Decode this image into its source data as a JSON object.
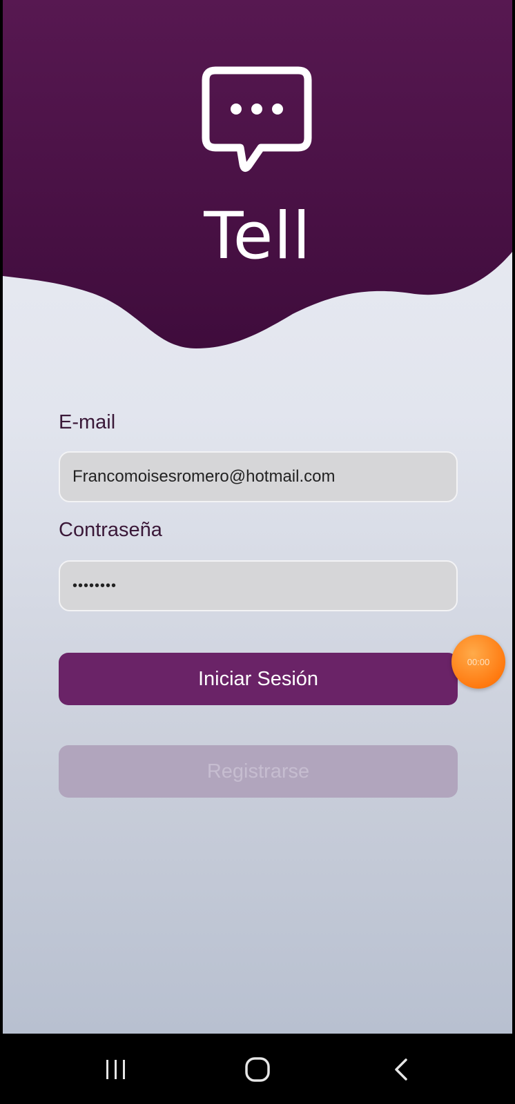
{
  "app": {
    "title": "Tell"
  },
  "login_form": {
    "email_label": "E-mail",
    "email_value": "Francomoisesromero@hotmail.com",
    "password_label": "Contraseña",
    "password_value": "••••••••"
  },
  "buttons": {
    "login_label": "Iniciar Sesión",
    "register_label": "Registrarse"
  },
  "overlay": {
    "timer_text": "00:00"
  },
  "colors": {
    "header_purple": "#4a1040",
    "button_purple": "#6a2367",
    "timer_orange": "#ff7a10"
  },
  "nav_bar": {
    "icons": [
      "recents-icon",
      "home-icon",
      "back-icon"
    ]
  }
}
